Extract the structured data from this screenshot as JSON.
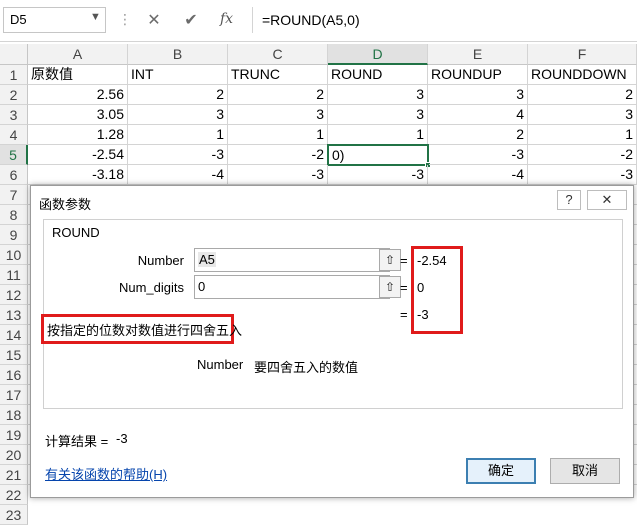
{
  "formula_bar": {
    "name_box": "D5",
    "cancel_symbol": "✕",
    "enter_symbol": "✔",
    "fx_label": "fx",
    "formula": "=ROUND(A5,0)"
  },
  "sheet": {
    "columns": [
      "A",
      "B",
      "C",
      "D",
      "E",
      "F"
    ],
    "rows": [
      "1",
      "2",
      "3",
      "4",
      "5",
      "6",
      "7",
      "8",
      "9",
      "10",
      "11",
      "12",
      "13",
      "14",
      "15",
      "16",
      "17",
      "18",
      "19",
      "20",
      "21",
      "22",
      "23"
    ],
    "header_row": [
      "原数值",
      "INT",
      "TRUNC",
      "ROUND",
      "ROUNDUP",
      "ROUNDDOWN"
    ],
    "data_rows": [
      [
        "2.56",
        "2",
        "2",
        "3",
        "3",
        "2"
      ],
      [
        "3.05",
        "3",
        "3",
        "3",
        "4",
        "3"
      ],
      [
        "1.28",
        "1",
        "1",
        "1",
        "2",
        "1"
      ],
      [
        "-2.54",
        "-3",
        "-2",
        "0)",
        "-3",
        "-2"
      ],
      [
        "-3.18",
        "-4",
        "-3",
        "-3",
        "-4",
        "-3"
      ]
    ]
  },
  "dialog": {
    "title": "函数参数",
    "help_symbol": "?",
    "close_symbol": "✕",
    "function_name": "ROUND",
    "args": [
      {
        "label": "Number",
        "value": "A5",
        "result": "-2.54"
      },
      {
        "label": "Num_digits",
        "value": "0",
        "result": "0"
      }
    ],
    "equals": "=",
    "ref_symbol": "⇧",
    "function_result": "-3",
    "description": "按指定的位数对数值进行四舍五入",
    "arg_desc_name": "Number",
    "arg_desc_text": "要四舍五入的数值",
    "calc_label": "计算结果 =",
    "calc_value": "-3",
    "help_link": "有关该函数的帮助(H)",
    "ok_label": "确定",
    "cancel_label": "取消"
  }
}
